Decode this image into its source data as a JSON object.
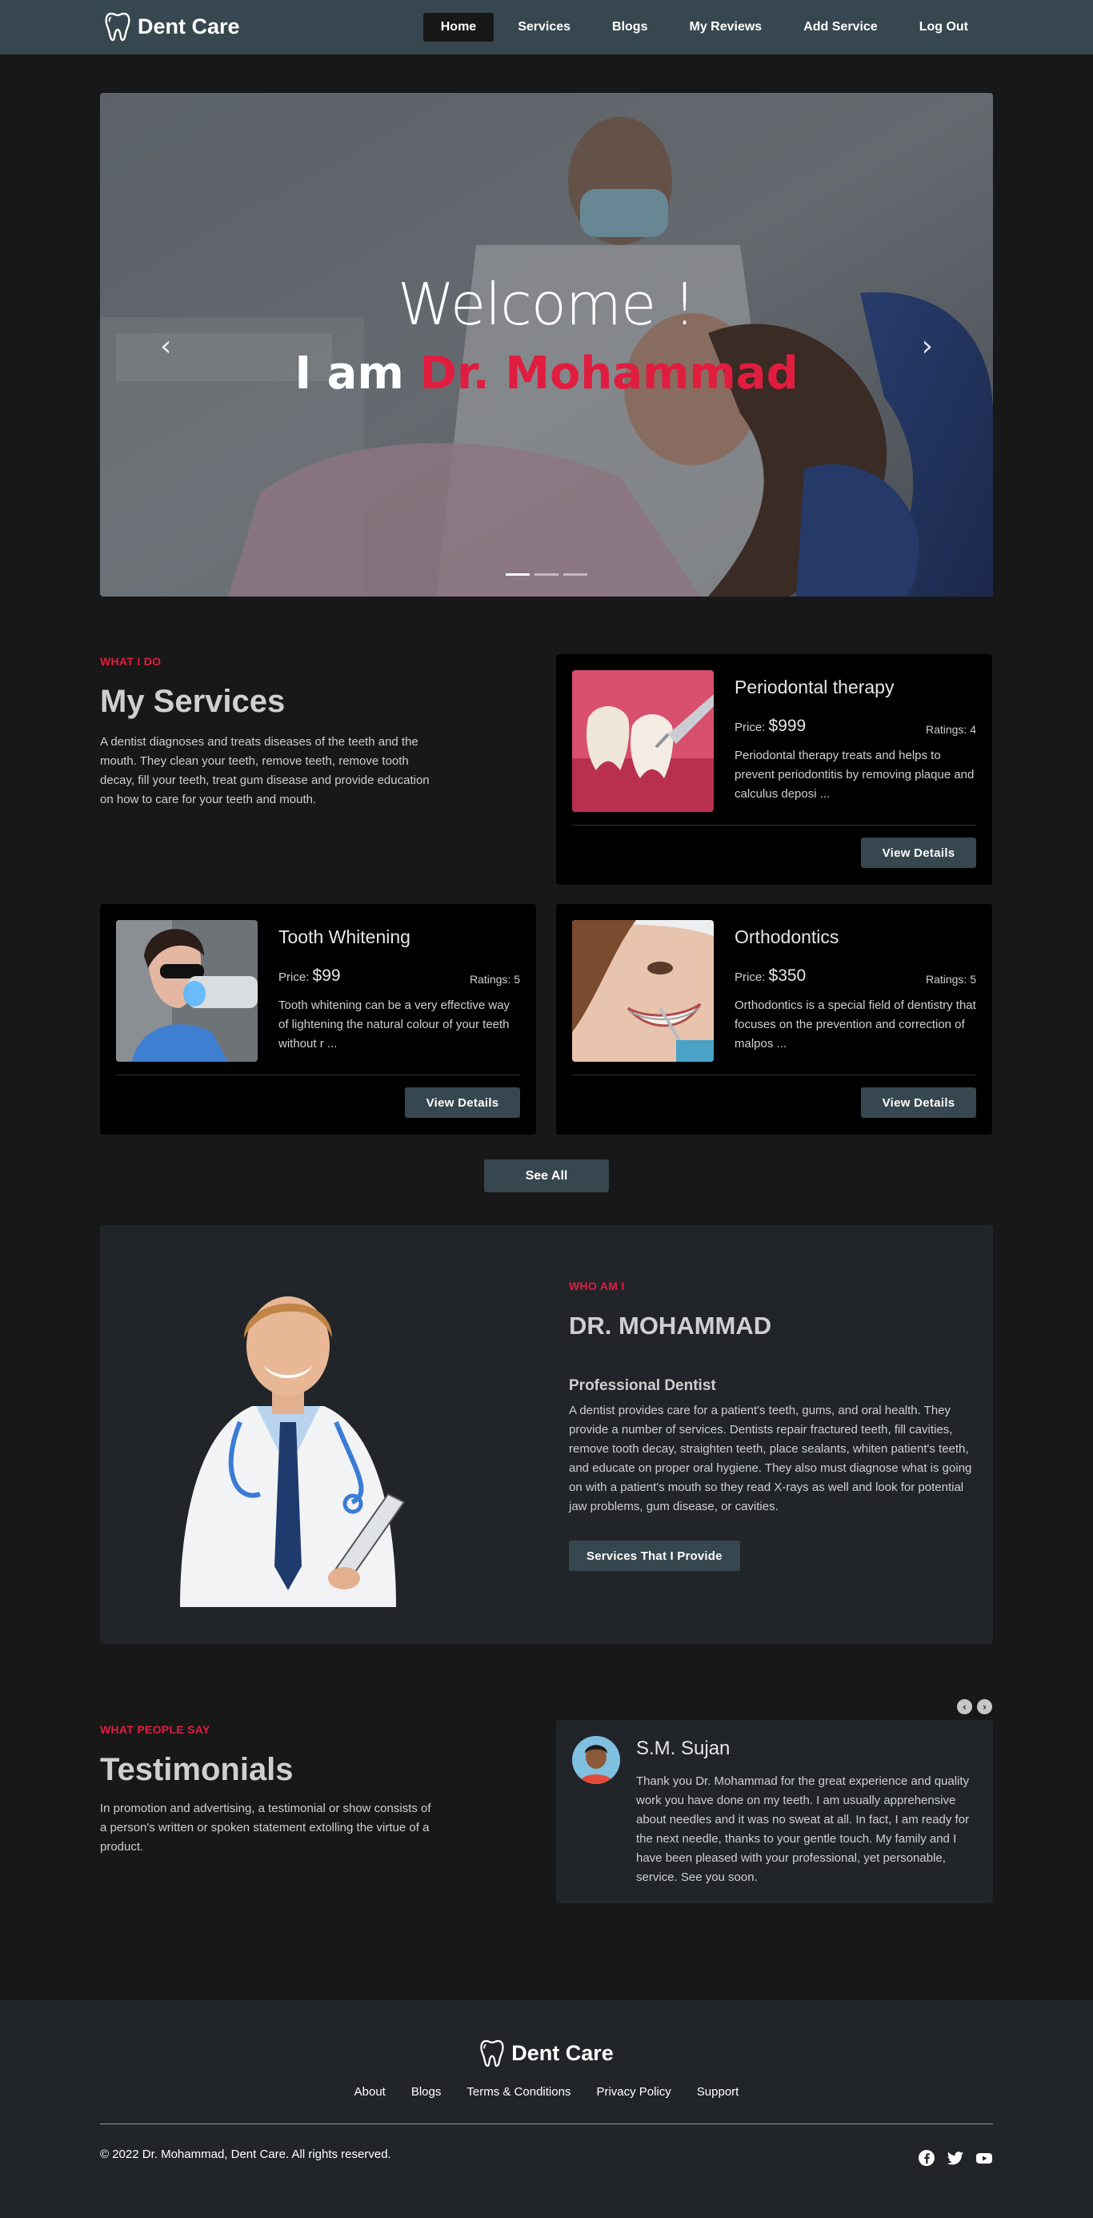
{
  "nav": {
    "brand": "Dent Care",
    "links": [
      "Home",
      "Services",
      "Blogs",
      "My Reviews",
      "Add Service",
      "Log Out"
    ],
    "active": "Home"
  },
  "hero": {
    "welcome": "Welcome !",
    "iam": "I am",
    "name": "Dr. Mohammad",
    "prev_icon": "chevron-left-icon",
    "next_icon": "chevron-right-icon"
  },
  "services": {
    "kicker": "WHAT I DO",
    "title": "My Services",
    "description": "A dentist diagnoses and treats diseases of the teeth and the mouth. They clean your teeth, remove teeth, remove tooth decay, fill your teeth, treat gum disease and provide education on how to care for your teeth and mouth.",
    "price_label": "Price:",
    "cards": [
      {
        "title": "Periodontal therapy",
        "price": "$999",
        "rating": "Ratings: 4",
        "description": "Periodontal therapy treats and helps to prevent periodontitis by removing plaque and calculus deposi ...",
        "button": "View Details"
      },
      {
        "title": "Tooth Whitening",
        "price": "$99",
        "rating": "Ratings: 5",
        "description": "Tooth whitening can be a very effective way of lightening the natural colour of your teeth without r ...",
        "button": "View Details"
      },
      {
        "title": "Orthodontics",
        "price": "$350",
        "rating": "Ratings: 5",
        "description": "Orthodontics is a special field of dentistry that focuses on the prevention and correction of malpos ...",
        "button": "View Details"
      }
    ],
    "see_all": "See All"
  },
  "about": {
    "kicker": "WHO AM I",
    "title": "DR. MOHAMMAD",
    "subtitle": "Professional Dentist",
    "description": "A dentist provides care for a patient's teeth, gums, and oral health. They provide a number of services. Dentists repair fractured teeth, fill cavities, remove tooth decay, straighten teeth, place sealants, whiten patient's teeth, and educate on proper oral hygiene. They also must diagnose what is going on with a patient's mouth so they read X-rays as well and look for potential jaw problems, gum disease, or cavities.",
    "button": "Services That I Provide"
  },
  "testimonials": {
    "kicker": "WHAT PEOPLE SAY",
    "title": "Testimonials",
    "description": "In promotion and advertising, a testimonial or show consists of a person's written or spoken statement extolling the virtue of a product.",
    "items": [
      {
        "name": "S.M. Sujan",
        "quote": "Thank you Dr. Mohammad for the great experience and quality work you have done on my teeth. I am usually apprehensive about needles and it was no sweat at all. In fact, I am ready for the next needle, thanks to your gentle touch. My family and I have been pleased with your professional, yet personable, service. See you soon."
      }
    ]
  },
  "footer": {
    "brand": "Dent Care",
    "links": [
      "About",
      "Blogs",
      "Terms & Conditions",
      "Privacy Policy",
      "Support"
    ],
    "copyright": "© 2022 Dr. Mohammad, Dent Care. All rights reserved.",
    "social": [
      "facebook-icon",
      "twitter-icon",
      "youtube-icon"
    ]
  },
  "colors": {
    "navbar": "#37474f",
    "accent_red": "#e11d3f",
    "page_bg": "#181818",
    "panel_bg": "#212529",
    "card_bg": "#000000"
  }
}
